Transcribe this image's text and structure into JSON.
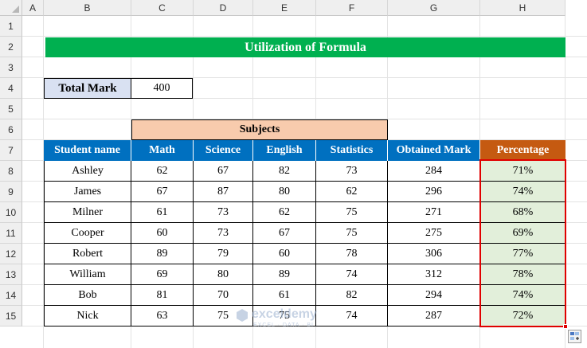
{
  "columns": [
    "A",
    "B",
    "C",
    "D",
    "E",
    "F",
    "G",
    "H"
  ],
  "rows": [
    "1",
    "2",
    "3",
    "4",
    "5",
    "6",
    "7",
    "8",
    "9",
    "10",
    "11",
    "12",
    "13",
    "14",
    "15"
  ],
  "title": "Utilization of Formula",
  "total_mark": {
    "label": "Total Mark",
    "value": "400"
  },
  "subjects_label": "Subjects",
  "table": {
    "headers": [
      "Student name",
      "Math",
      "Science",
      "English",
      "Statistics",
      "Obtained Mark",
      "Percentage"
    ],
    "rows": [
      [
        "Ashley",
        "62",
        "67",
        "82",
        "73",
        "284",
        "71%"
      ],
      [
        "James",
        "67",
        "87",
        "80",
        "62",
        "296",
        "74%"
      ],
      [
        "Milner",
        "61",
        "73",
        "62",
        "75",
        "271",
        "68%"
      ],
      [
        "Cooper",
        "60",
        "73",
        "67",
        "75",
        "275",
        "69%"
      ],
      [
        "Robert",
        "89",
        "79",
        "60",
        "78",
        "306",
        "77%"
      ],
      [
        "William",
        "69",
        "80",
        "89",
        "74",
        "312",
        "78%"
      ],
      [
        "Bob",
        "81",
        "70",
        "61",
        "82",
        "294",
        "74%"
      ],
      [
        "Nick",
        "63",
        "75",
        "75",
        "74",
        "287",
        "72%"
      ]
    ]
  },
  "watermark": {
    "brand": "exceldemy",
    "tagline": "EXCEL · DATA · BI"
  },
  "colors": {
    "title_bg": "#00b050",
    "header_bg": "#0070c0",
    "percentage_header_bg": "#c55a11",
    "subjects_bg": "#f8cbad",
    "total_mark_bg": "#d9e1f2",
    "percentage_cell_bg": "#e2efda",
    "selection_border": "#e00000"
  },
  "icons": {
    "quick_analysis": "quick-analysis-icon"
  }
}
